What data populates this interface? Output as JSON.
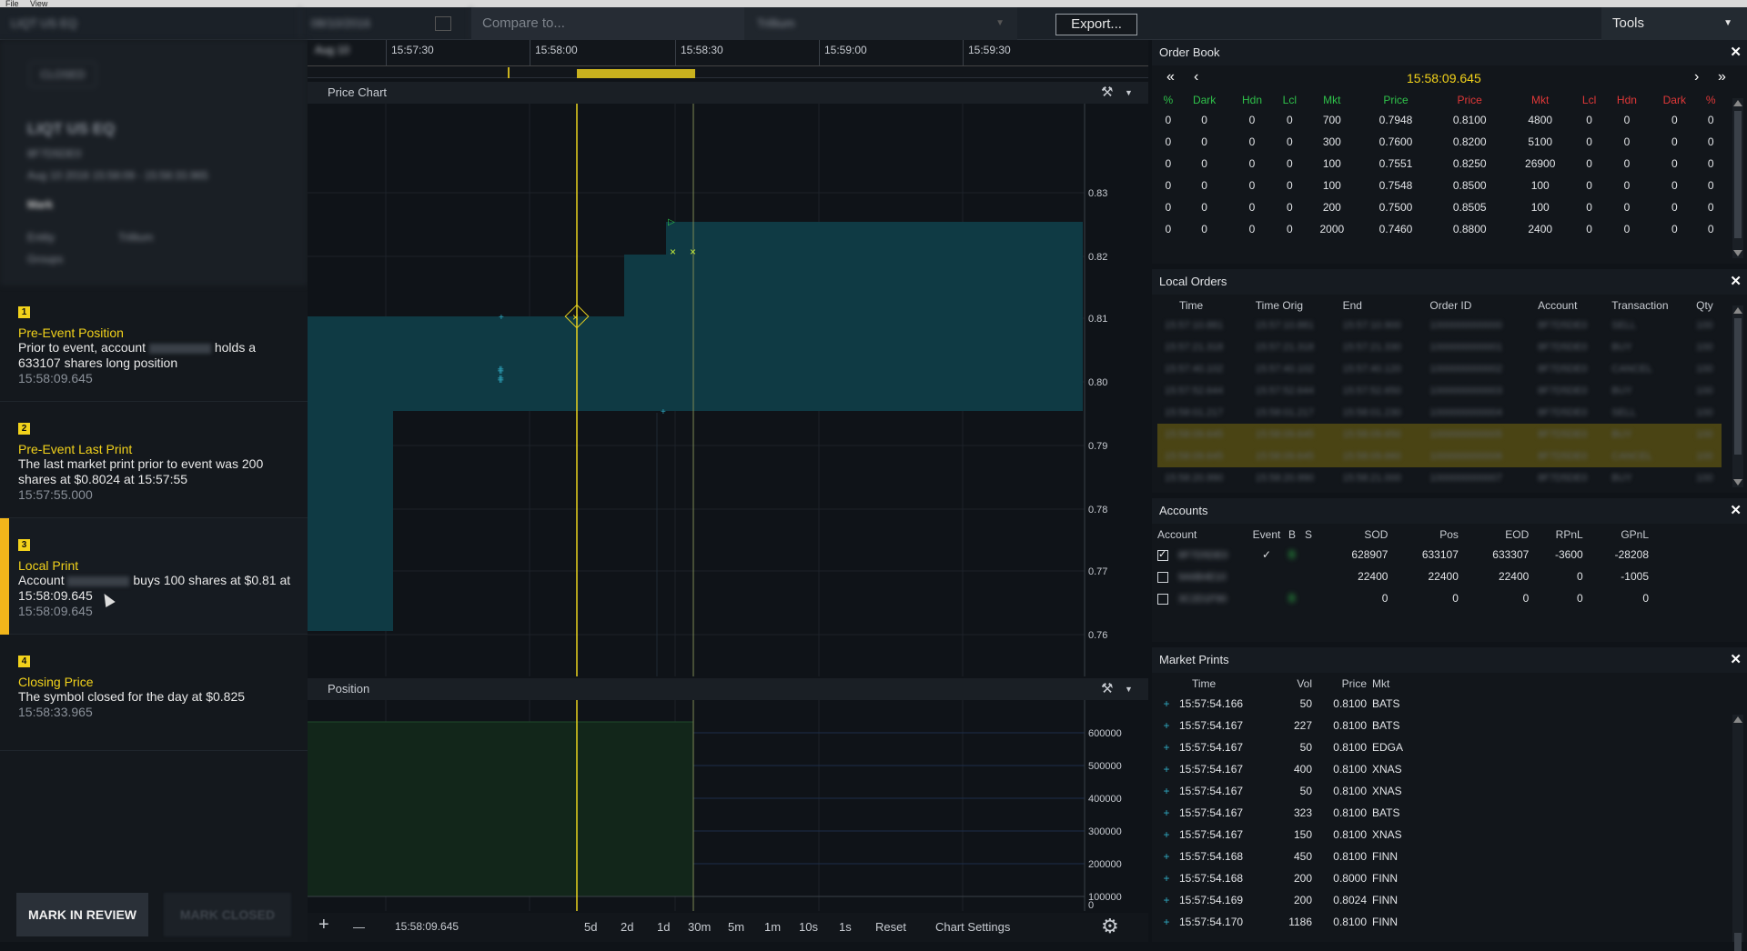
{
  "menu": [
    "File",
    "View"
  ],
  "topbar": {
    "symbol": "LIQT US EQ",
    "date": "08/10/2016",
    "compare_placeholder": "Compare to...",
    "entity": "Trillium",
    "export_label": "Export...",
    "tools_label": "Tools"
  },
  "case": {
    "status": "CLOSED",
    "title": "LIQT US EQ",
    "id": "8F7D5DE0",
    "range": "Aug 10 2016 15:58:09 - 15:58:33.965",
    "type": "Mark",
    "entity_label": "Entity",
    "entity_value": "Trillium",
    "groups_label": "Groups"
  },
  "events": [
    {
      "num": "1",
      "title": "Pre-Event Position",
      "desc_pre": "Prior to event, account",
      "desc_post": "holds a 633107 shares long position",
      "time": "15:58:09.645"
    },
    {
      "num": "2",
      "title": "Pre-Event Last Print",
      "desc": "The last market print prior to event was 200 shares at $0.8024 at 15:57:55",
      "time": "15:57:55.000"
    },
    {
      "num": "3",
      "title": "Local Print",
      "desc_pre": "Account",
      "desc_post": "buys 100 shares at $0.81 at 15:58:09.645",
      "time": "15:58:09.645"
    },
    {
      "num": "4",
      "title": "Closing Price",
      "desc": "The symbol closed for the day at $0.825",
      "time": "15:58:33.965"
    }
  ],
  "buttons": {
    "review": "MARK IN REVIEW",
    "closed": "MARK CLOSED"
  },
  "timeline": {
    "start_label": "Aug 10",
    "ticks": [
      "15:57:30",
      "15:58:00",
      "15:58:30",
      "15:59:00",
      "15:59:30"
    ]
  },
  "price_chart": {
    "title": "Price Chart",
    "yticks": [
      "0.83",
      "0.82",
      "0.81",
      "0.80",
      "0.79",
      "0.78",
      "0.77",
      "0.76"
    ]
  },
  "position_chart": {
    "title": "Position",
    "yticks": [
      "600000",
      "500000",
      "400000",
      "300000",
      "200000",
      "100000",
      "0"
    ]
  },
  "bottombar": {
    "plus": "+",
    "minus": "—",
    "time": "15:58:09.645",
    "ranges": [
      "5d",
      "2d",
      "1d",
      "30m",
      "5m",
      "1m",
      "10s",
      "1s"
    ],
    "reset": "Reset",
    "settings": "Chart Settings"
  },
  "order_book": {
    "title": "Order Book",
    "time": "15:58:09.645",
    "headers": [
      "%",
      "Dark",
      "Hdn",
      "Lcl",
      "Mkt",
      "Price",
      "Price",
      "Mkt",
      "Lcl",
      "Hdn",
      "Dark",
      "%"
    ],
    "rows": [
      [
        "0",
        "0",
        "0",
        "0",
        "700",
        "0.7948",
        "0.8100",
        "4800",
        "0",
        "0",
        "0",
        "0"
      ],
      [
        "0",
        "0",
        "0",
        "0",
        "300",
        "0.7600",
        "0.8200",
        "5100",
        "0",
        "0",
        "0",
        "0"
      ],
      [
        "0",
        "0",
        "0",
        "0",
        "100",
        "0.7551",
        "0.8250",
        "26900",
        "0",
        "0",
        "0",
        "0"
      ],
      [
        "0",
        "0",
        "0",
        "0",
        "100",
        "0.7548",
        "0.8500",
        "100",
        "0",
        "0",
        "0",
        "0"
      ],
      [
        "0",
        "0",
        "0",
        "0",
        "200",
        "0.7500",
        "0.8505",
        "100",
        "0",
        "0",
        "0",
        "0"
      ],
      [
        "0",
        "0",
        "0",
        "0",
        "2000",
        "0.7460",
        "0.8800",
        "2400",
        "0",
        "0",
        "0",
        "0"
      ]
    ]
  },
  "local_orders": {
    "title": "Local Orders",
    "headers": [
      "Time",
      "Time Orig",
      "End",
      "Order ID",
      "Account",
      "Transaction",
      "Qty"
    ],
    "rows": [
      [
        "15:57:10.881",
        "15:57:10.881",
        "15:57:10.900",
        "1000000000000",
        "8F7D5DE0",
        "SELL",
        "100"
      ],
      [
        "15:57:21.318",
        "15:57:21.318",
        "15:57:21.330",
        "1000000000001",
        "8F7D5DE0",
        "BUY",
        "100"
      ],
      [
        "15:57:40.102",
        "15:57:40.102",
        "15:57:40.120",
        "1000000000002",
        "8F7D5DE0",
        "CANCEL",
        "100"
      ],
      [
        "15:57:52.644",
        "15:57:52.644",
        "15:57:52.650",
        "1000000000003",
        "8F7D5DE0",
        "BUY",
        "100"
      ],
      [
        "15:58:01.217",
        "15:58:01.217",
        "15:58:01.230",
        "1000000000004",
        "8F7D5DE0",
        "SELL",
        "100"
      ],
      [
        "15:58:09.645",
        "15:58:09.645",
        "15:58:09.650",
        "1000000000005",
        "8F7D5DE0",
        "BUY",
        "100"
      ],
      [
        "15:58:09.645",
        "15:58:09.645",
        "15:58:09.660",
        "1000000000006",
        "8F7D5DE0",
        "CANCEL",
        "100"
      ],
      [
        "15:58:20.990",
        "15:58:20.990",
        "15:58:21.000",
        "1000000000007",
        "8F7D5DE0",
        "BUY",
        "100"
      ]
    ]
  },
  "accounts": {
    "title": "Accounts",
    "headers": [
      "Account",
      "Event",
      "B",
      "S",
      "SOD",
      "Pos",
      "EOD",
      "RPnL",
      "GPnL"
    ],
    "rows": [
      {
        "checked": true,
        "account": "8F7D5DE0",
        "event": "✓",
        "b": "B",
        "s": "",
        "sod": "628907",
        "pos": "633107",
        "eod": "633307",
        "rpnl": "-3600",
        "gpnl": "-28208"
      },
      {
        "checked": false,
        "account": "9A6B4E10",
        "event": "",
        "b": "",
        "s": "",
        "sod": "22400",
        "pos": "22400",
        "eod": "22400",
        "rpnl": "0",
        "gpnl": "-1005"
      },
      {
        "checked": false,
        "account": "3C2D1F90",
        "event": "",
        "b": "B",
        "s": "",
        "sod": "0",
        "pos": "0",
        "eod": "0",
        "rpnl": "0",
        "gpnl": "0"
      }
    ]
  },
  "market_prints": {
    "title": "Market Prints",
    "headers": [
      "Time",
      "Vol",
      "Price",
      "Mkt"
    ],
    "rows": [
      [
        "15:57:54.166",
        "50",
        "0.8100",
        "BATS"
      ],
      [
        "15:57:54.167",
        "227",
        "0.8100",
        "BATS"
      ],
      [
        "15:57:54.167",
        "50",
        "0.8100",
        "EDGA"
      ],
      [
        "15:57:54.167",
        "400",
        "0.8100",
        "XNAS"
      ],
      [
        "15:57:54.167",
        "50",
        "0.8100",
        "XNAS"
      ],
      [
        "15:57:54.167",
        "323",
        "0.8100",
        "BATS"
      ],
      [
        "15:57:54.167",
        "150",
        "0.8100",
        "XNAS"
      ],
      [
        "15:57:54.168",
        "450",
        "0.8100",
        "FINN"
      ],
      [
        "15:57:54.168",
        "200",
        "0.8000",
        "FINN"
      ],
      [
        "15:57:54.169",
        "200",
        "0.8024",
        "FINN"
      ],
      [
        "15:57:54.170",
        "1186",
        "0.8100",
        "FINN"
      ]
    ]
  }
}
